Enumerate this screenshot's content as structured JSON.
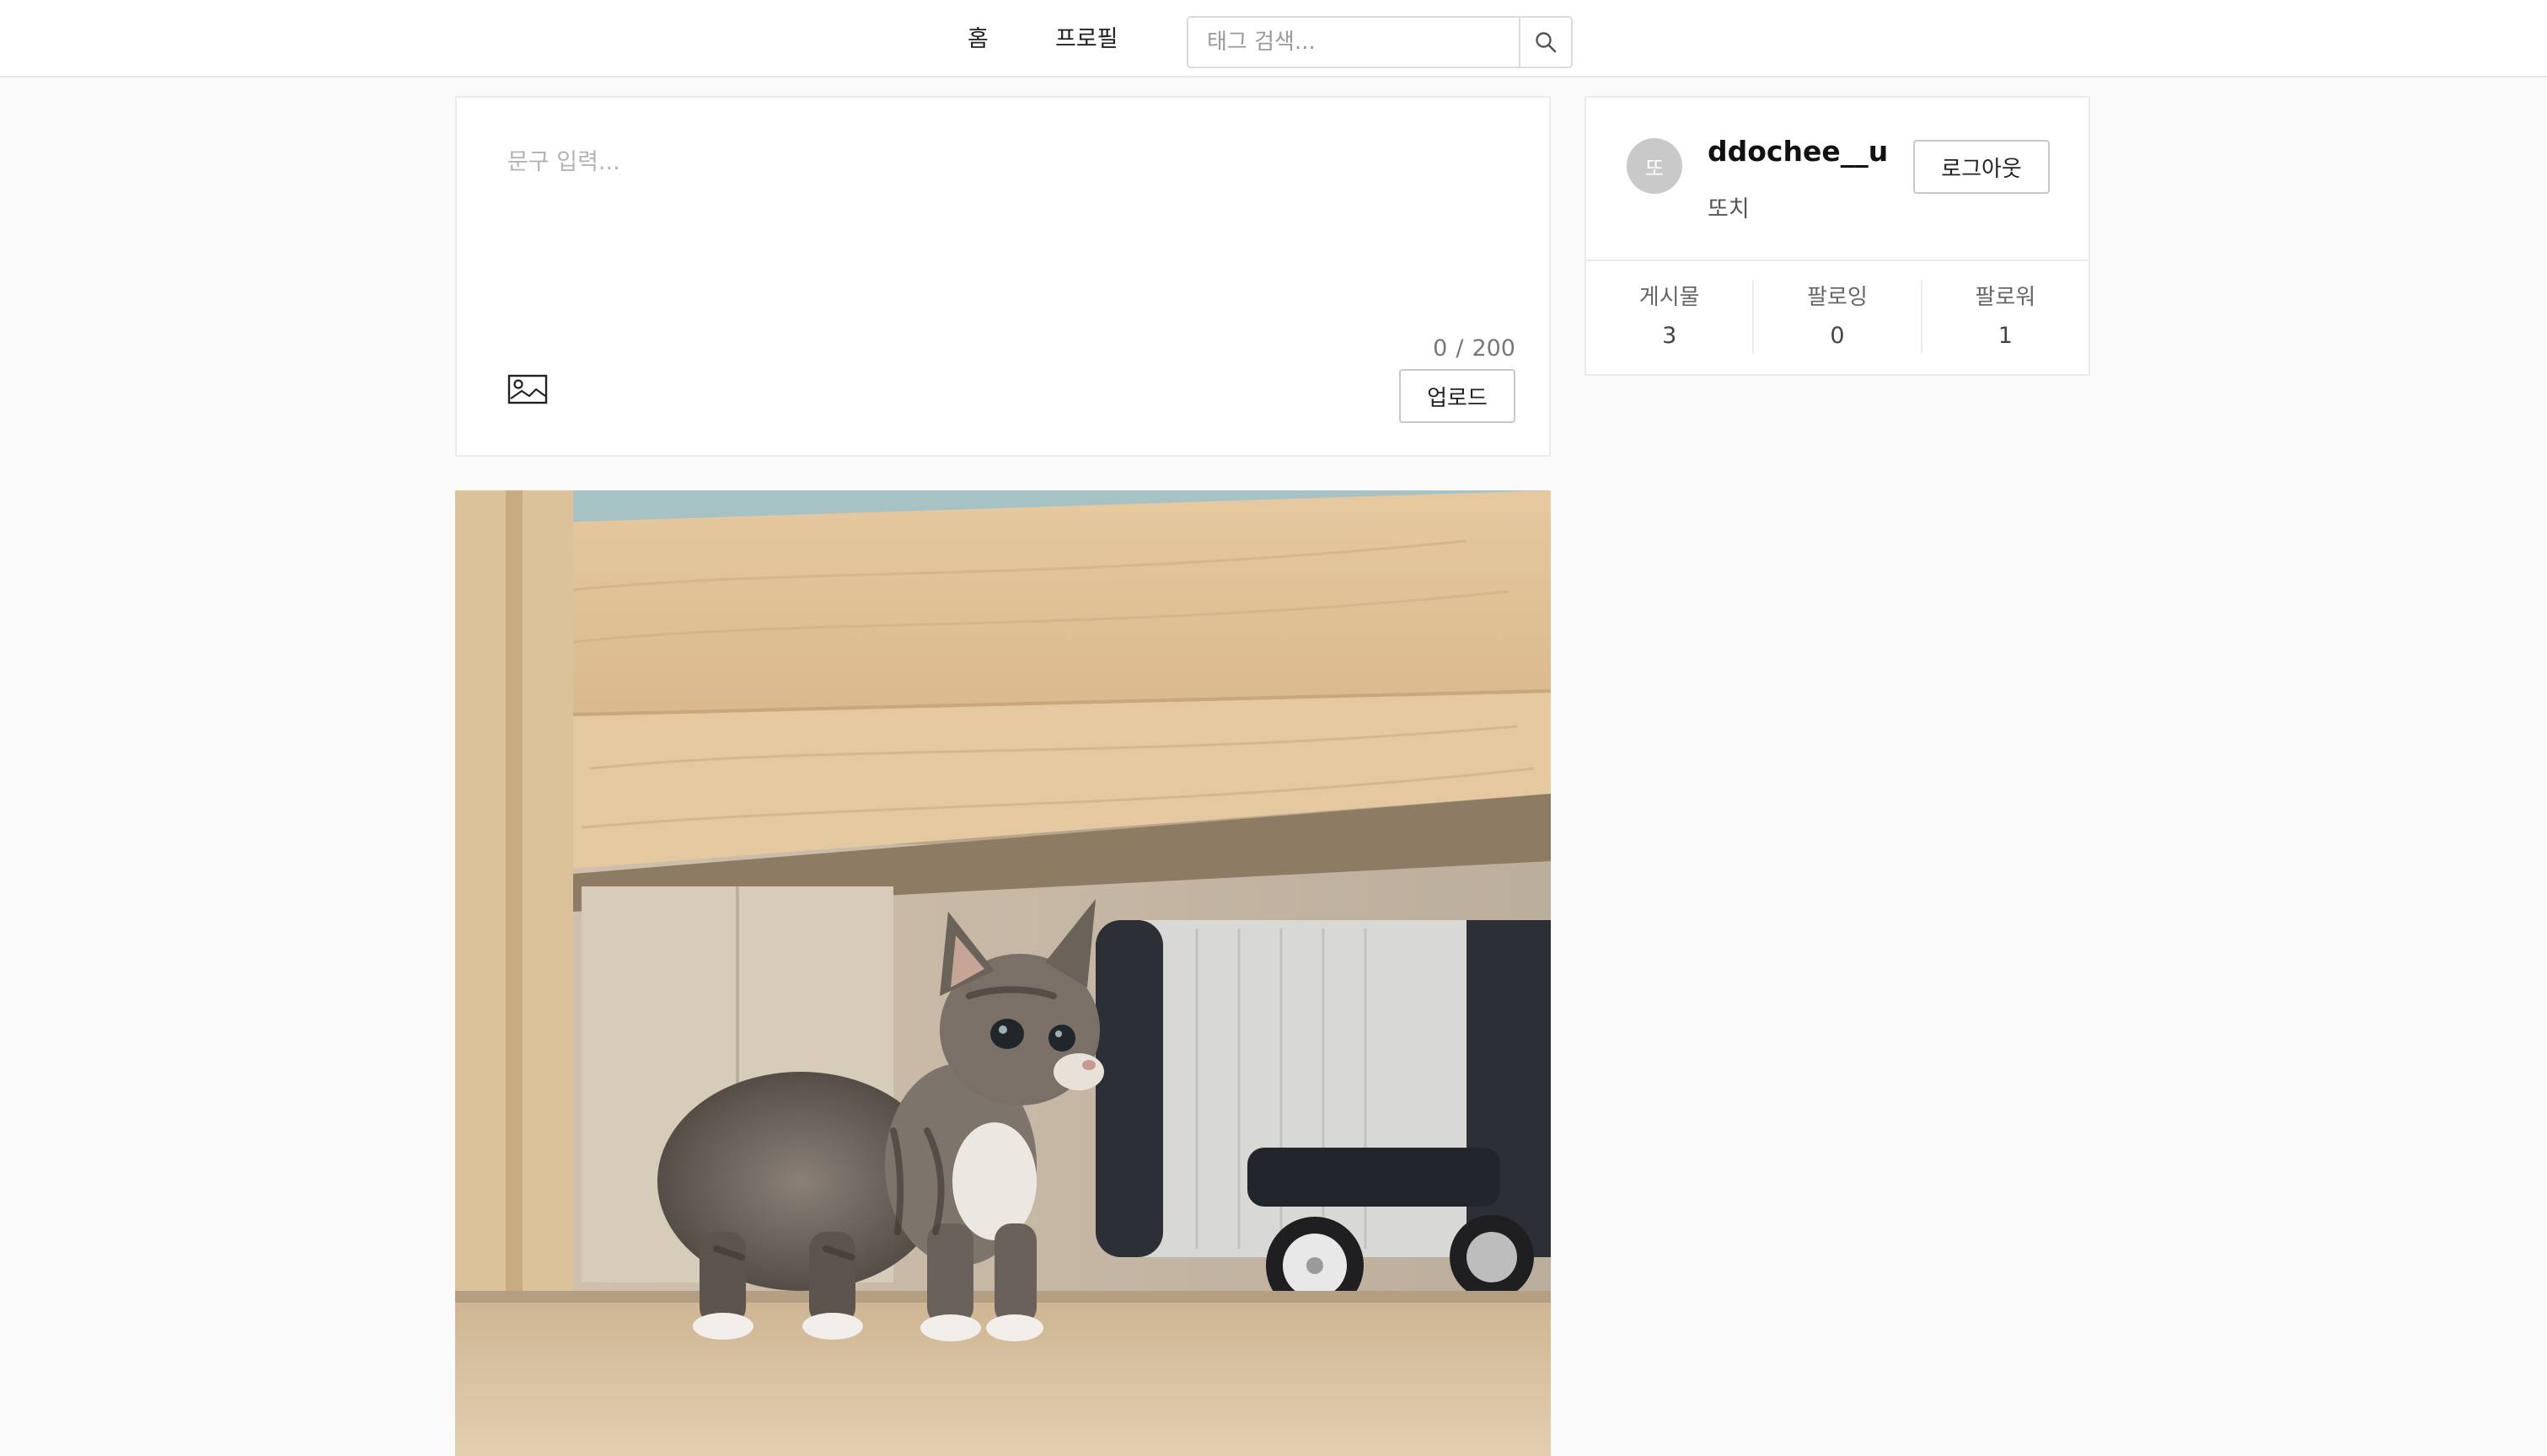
{
  "nav": {
    "home_label": "홈",
    "profile_label": "프로필",
    "search": {
      "placeholder": "태그 검색...",
      "value": "",
      "icon": "search-icon"
    }
  },
  "composer": {
    "placeholder": "문구 입력...",
    "value": "",
    "char_count": "0",
    "char_separator": "/",
    "char_limit": "200",
    "image_icon": "image-icon",
    "upload_label": "업로드"
  },
  "profile": {
    "avatar_initial": "또",
    "username": "ddochee__u",
    "display_name": "또치",
    "logout_label": "로그아웃",
    "stats": [
      {
        "label": "게시물",
        "value": "3"
      },
      {
        "label": "팔로잉",
        "value": "0"
      },
      {
        "label": "팔로워",
        "value": "1"
      }
    ]
  },
  "colors": {
    "background": "#fafafa",
    "card": "#ffffff",
    "border": "#ebebeb",
    "avatar": "#c9c9c9"
  }
}
